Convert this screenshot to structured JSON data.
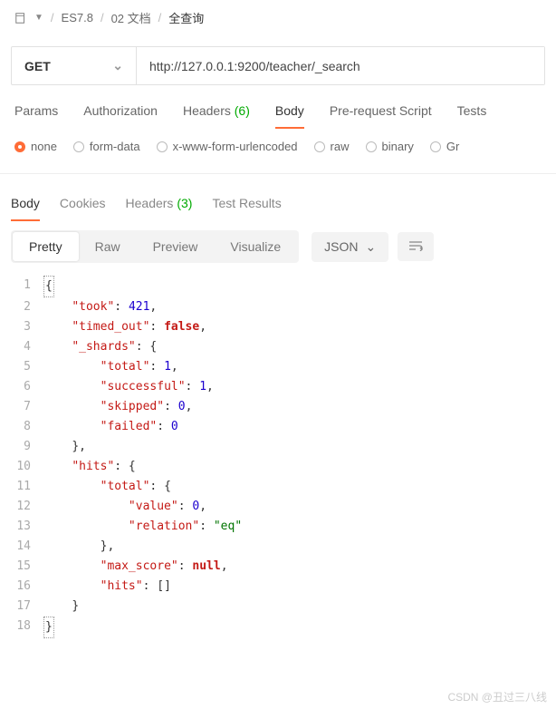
{
  "breadcrumb": {
    "root": "ES7.8",
    "folder": "02 文档",
    "item": "全查询"
  },
  "request": {
    "method": "GET",
    "url": "http://127.0.0.1:9200/teacher/_search"
  },
  "reqTabs": {
    "params": "Params",
    "auth": "Authorization",
    "headers": "Headers",
    "headersCount": "(6)",
    "body": "Body",
    "prerequest": "Pre-request Script",
    "tests": "Tests"
  },
  "bodyTypes": {
    "none": "none",
    "formdata": "form-data",
    "urlencoded": "x-www-form-urlencoded",
    "raw": "raw",
    "binary": "binary",
    "graphql": "Gr"
  },
  "respTabs": {
    "body": "Body",
    "cookies": "Cookies",
    "headers": "Headers",
    "headersCount": "(3)",
    "tests": "Test Results"
  },
  "viewBtns": {
    "pretty": "Pretty",
    "raw": "Raw",
    "preview": "Preview",
    "visualize": "Visualize"
  },
  "format": "JSON",
  "code": {
    "l1": "{",
    "l2a": "\"took\"",
    "l2b": ": ",
    "l2c": "421",
    "l2d": ",",
    "l3a": "\"timed_out\"",
    "l3b": ": ",
    "l3c": "false",
    "l3d": ",",
    "l4a": "\"_shards\"",
    "l4b": ": {",
    "l5a": "\"total\"",
    "l5b": ": ",
    "l5c": "1",
    "l5d": ",",
    "l6a": "\"successful\"",
    "l6b": ": ",
    "l6c": "1",
    "l6d": ",",
    "l7a": "\"skipped\"",
    "l7b": ": ",
    "l7c": "0",
    "l7d": ",",
    "l8a": "\"failed\"",
    "l8b": ": ",
    "l8c": "0",
    "l9": "},",
    "l10a": "\"hits\"",
    "l10b": ": {",
    "l11a": "\"total\"",
    "l11b": ": {",
    "l12a": "\"value\"",
    "l12b": ": ",
    "l12c": "0",
    "l12d": ",",
    "l13a": "\"relation\"",
    "l13b": ": ",
    "l13c": "\"eq\"",
    "l14": "},",
    "l15a": "\"max_score\"",
    "l15b": ": ",
    "l15c": "null",
    "l15d": ",",
    "l16a": "\"hits\"",
    "l16b": ": []",
    "l17": "}",
    "l18": "}"
  },
  "lineNums": [
    "1",
    "2",
    "3",
    "4",
    "5",
    "6",
    "7",
    "8",
    "9",
    "10",
    "11",
    "12",
    "13",
    "14",
    "15",
    "16",
    "17",
    "18"
  ],
  "watermark": "CSDN @丑过三八线"
}
